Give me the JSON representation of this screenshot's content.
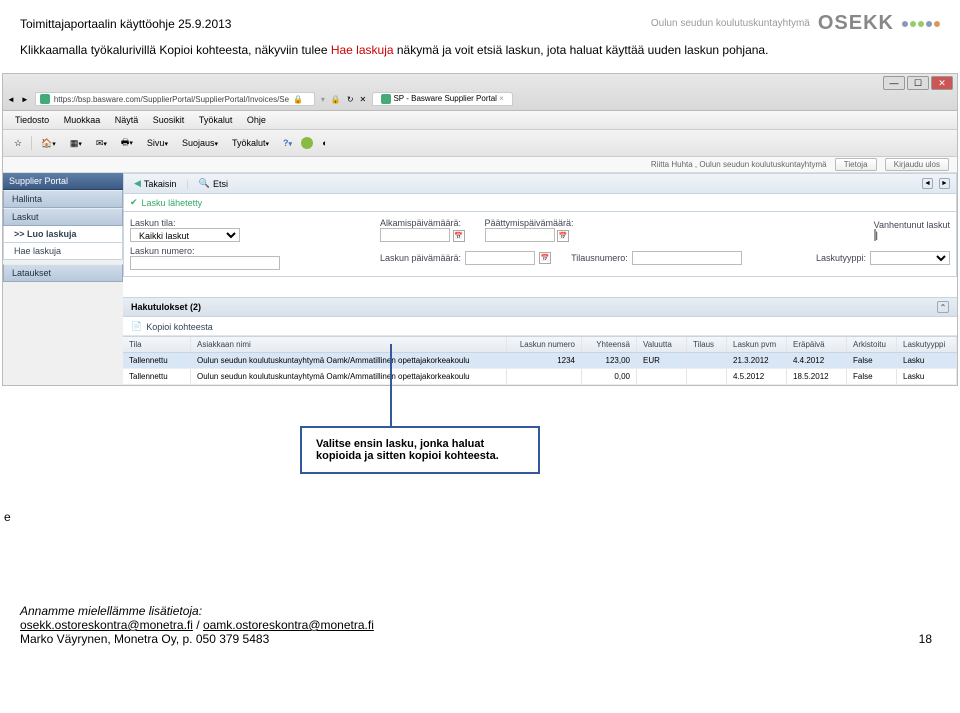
{
  "doc": {
    "title": "Toimittajaportaalin käyttöohje 25.9.2013",
    "logo_sub": "Oulun seudun koulutuskuntayhtymä",
    "logo_main": "OSEKK",
    "intro_prefix": "Klikkaamalla työkalurivillä Kopioi kohteesta, näkyviin tulee ",
    "intro_red": "Hae laskuja",
    "intro_suffix": " näkymä ja voit etsiä laskun, jota haluat käyttää uuden laskun pohjana.",
    "page_num": "18",
    "e_marker": "e"
  },
  "browser": {
    "url": "https://bsp.basware.com/SupplierPortal/SupplierPortal/Invoices/Se",
    "tab_title": "SP - Basware Supplier Portal"
  },
  "menu": [
    "Tiedosto",
    "Muokkaa",
    "Näytä",
    "Suosikit",
    "Työkalut",
    "Ohje"
  ],
  "toolbar": {
    "sivu": "Sivu",
    "suojaus": "Suojaus",
    "tyokalut": "Työkalut"
  },
  "userbar": {
    "user": "Riitta Huhta , Oulun seudun koulutuskuntayhtymä",
    "tietoja": "Tietoja",
    "kirjaudu": "Kirjaudu ulos"
  },
  "sidebar": {
    "portal": "Supplier Portal",
    "hallinta": "Hallinta",
    "laskut": "Laskut",
    "luo": ">> Luo laskuja",
    "hae": "Hae laskuja",
    "lataukset": "Lataukset"
  },
  "tools": {
    "takaisin": "Takaisin",
    "etsi": "Etsi"
  },
  "status": {
    "lahetetty": "Lasku lähetetty"
  },
  "filters": {
    "tila_label": "Laskun tila:",
    "tila_value": "Kaikki laskut",
    "alkamis": "Alkamispäivämäärä:",
    "paattymis": "Päättymispäivämäärä:",
    "vanhentunut": "Vanhentunut laskut",
    "numero_label": "Laskun numero:",
    "paiva_label": "Laskun päivämäärä:",
    "tilaus_label": "Tilausnumero:",
    "tyyppi_label": "Laskutyyppi:"
  },
  "results": {
    "header": "Hakutulokset (2)",
    "kopioi": "Kopioi kohteesta",
    "columns": {
      "tila": "Tila",
      "asiakas": "Asiakkaan nimi",
      "numero": "Laskun numero",
      "yhteensa": "Yhteensä",
      "valuutta": "Valuutta",
      "tilaus": "Tilaus",
      "pvm": "Laskun pvm",
      "erapaiva": "Eräpäivä",
      "arkistoitu": "Arkistoitu",
      "tyyppi": "Laskutyyppi"
    },
    "rows": [
      {
        "tila": "Tallennettu",
        "asiakas": "Oulun seudun koulutuskuntayhtymä Oamk/Ammatillinen opettajakorkeakoulu",
        "numero": "1234",
        "yht": "123,00",
        "val": "EUR",
        "tilaus": "",
        "pvm": "21.3.2012",
        "era": "4.4.2012",
        "ark": "False",
        "tyyppi": "Lasku"
      },
      {
        "tila": "Tallennettu",
        "asiakas": "Oulun seudun koulutuskuntayhtymä Oamk/Ammatillinen opettajakorkeakoulu",
        "numero": "",
        "yht": "0,00",
        "val": "",
        "tilaus": "",
        "pvm": "4.5.2012",
        "era": "18.5.2012",
        "ark": "False",
        "tyyppi": "Lasku"
      }
    ]
  },
  "callout": "Valitse ensin lasku, jonka haluat kopioida ja sitten kopioi kohteesta.",
  "footer": {
    "line1": "Annamme mielellämme lisätietoja:",
    "email1": "osekk.ostoreskontra@monetra.fi",
    "sep": "  / ",
    "email2": "oamk.ostoreskontra@monetra.fi",
    "line3": "Marko Väyrynen, Monetra Oy, p. 050 379 5483"
  }
}
